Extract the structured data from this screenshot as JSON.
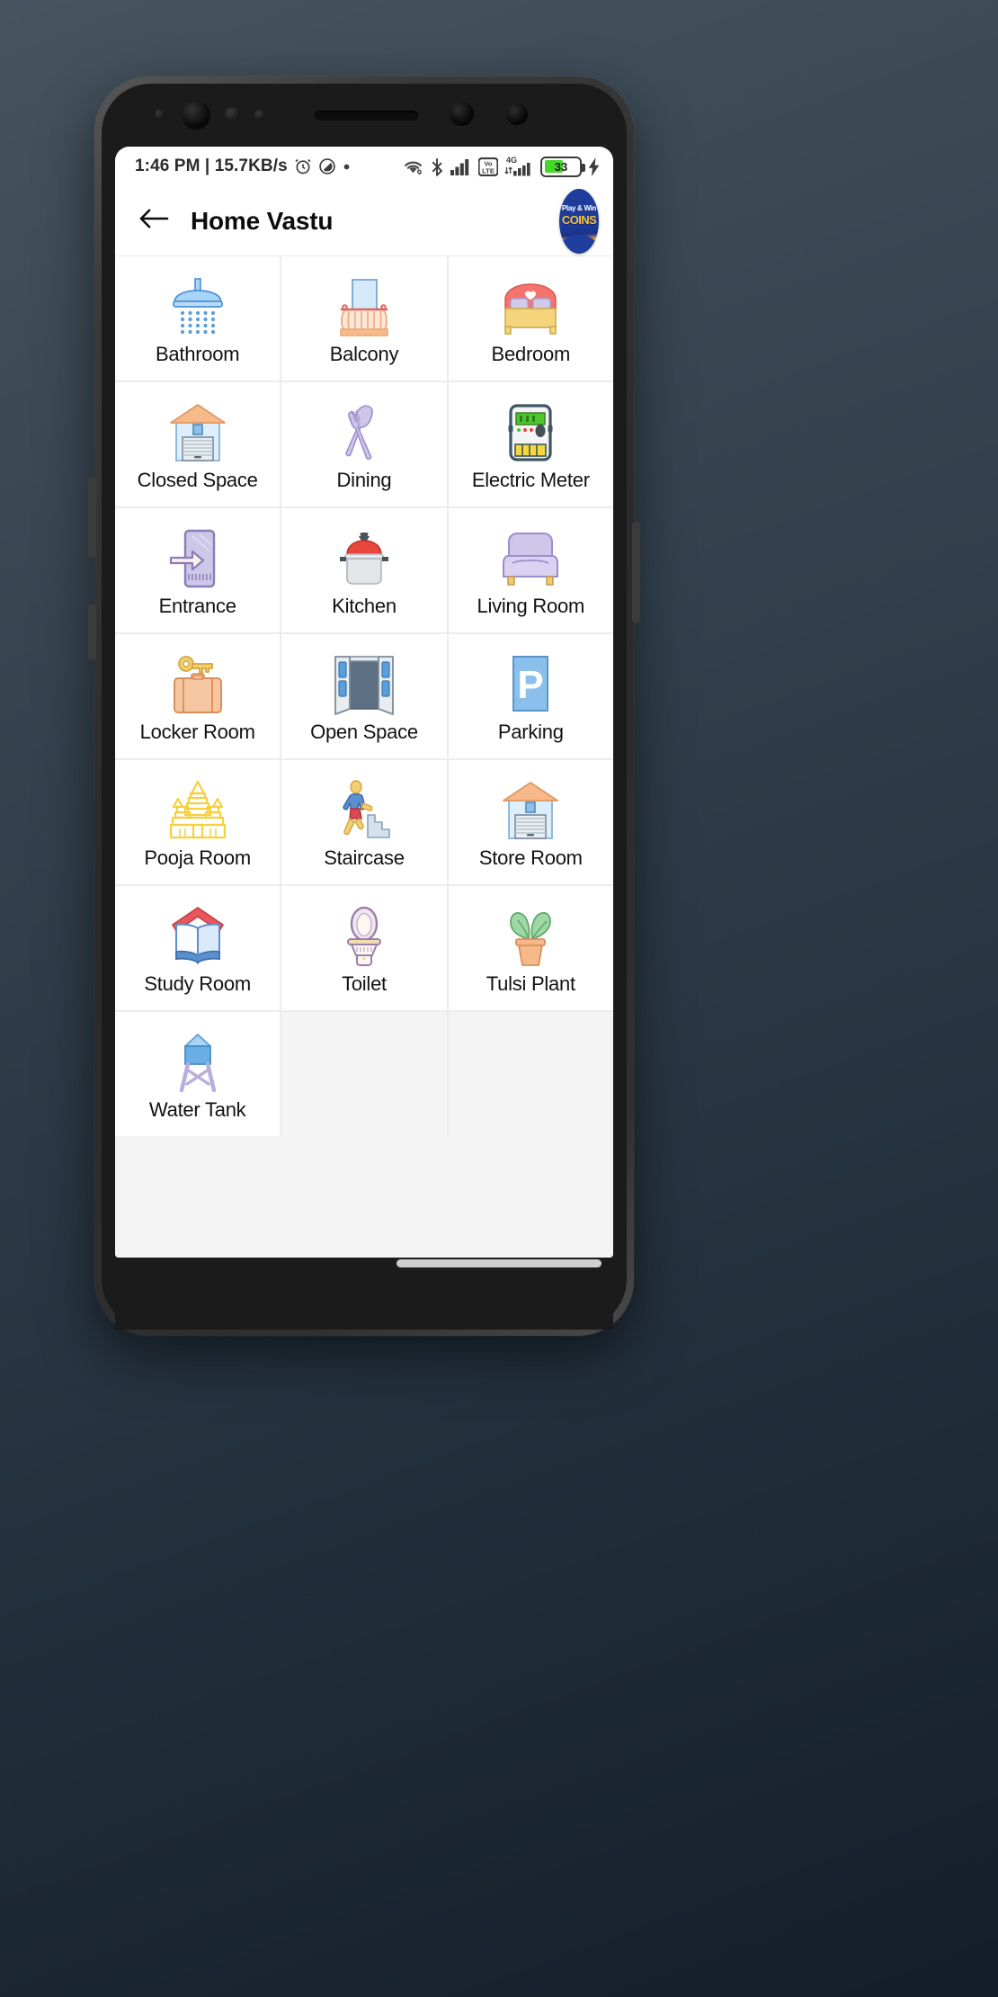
{
  "status_bar": {
    "clock": "1:46 PM",
    "separator": "|",
    "net_speed": "15.7KB/s",
    "alarm_icon": "alarm-clock-icon",
    "dnd_icon": "do-not-disturb-icon",
    "dot_icon": "notification-dot-icon",
    "wifi_icon": "wifi-icon",
    "bluetooth_icon": "bluetooth-icon",
    "signal_icon": "cellular-signal-icon",
    "volte_label_top": "Vo",
    "volte_label_bottom": "LTE",
    "network_type": "4G",
    "signal2_icon": "cellular-signal-2-icon",
    "battery_level": "33",
    "charging_icon": "charging-bolt-icon"
  },
  "app_bar": {
    "back_icon": "back-arrow-icon",
    "title": "Home Vastu",
    "logo": {
      "top_text": "Play & Win",
      "main_text": "COINS",
      "name": "app-logo"
    }
  },
  "grid": {
    "items": [
      {
        "label": "Bathroom",
        "icon": "shower-head-icon"
      },
      {
        "label": "Balcony",
        "icon": "balcony-railing-icon"
      },
      {
        "label": "Bedroom",
        "icon": "double-bed-icon"
      },
      {
        "label": "Closed Space",
        "icon": "closed-garage-icon"
      },
      {
        "label": "Dining",
        "icon": "fork-spoon-icon"
      },
      {
        "label": "Electric Meter",
        "icon": "electric-meter-icon"
      },
      {
        "label": "Entrance",
        "icon": "door-arrow-icon"
      },
      {
        "label": "Kitchen",
        "icon": "cooking-pot-icon"
      },
      {
        "label": "Living Room",
        "icon": "armchair-icon"
      },
      {
        "label": "Locker Room",
        "icon": "key-suitcase-icon"
      },
      {
        "label": "Open Space",
        "icon": "open-doors-icon"
      },
      {
        "label": "Parking",
        "icon": "parking-sign-icon"
      },
      {
        "label": "Pooja Room",
        "icon": "temple-icon"
      },
      {
        "label": "Staircase",
        "icon": "person-stairs-icon"
      },
      {
        "label": "Store Room",
        "icon": "storage-garage-icon"
      },
      {
        "label": "Study Room",
        "icon": "open-book-house-icon"
      },
      {
        "label": "Toilet",
        "icon": "toilet-icon"
      },
      {
        "label": "Tulsi Plant",
        "icon": "potted-plant-icon"
      },
      {
        "label": "Water Tank",
        "icon": "water-tower-icon"
      }
    ]
  },
  "colors": {
    "battery_green": "#45d62a",
    "card_bg": "#ffffff",
    "grid_bg": "#f4f4f4",
    "title_text": "#0d0d0d",
    "logo_blue": "#1f3e9e",
    "logo_yellow": "#f5c23b"
  }
}
